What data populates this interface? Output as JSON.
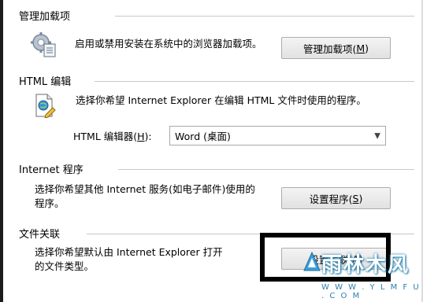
{
  "addons": {
    "title": "管理加载项",
    "description": "启用或禁用安装在系统中的浏览器加载项。",
    "button_text": "管理加载项(",
    "button_key": "M",
    "button_close": ")"
  },
  "html_editor": {
    "title": "HTML 编辑",
    "description": "选择你希望 Internet Explorer 在编辑 HTML 文件时使用的程序。",
    "label_text": "HTML 编辑器(",
    "label_key": "H",
    "label_close": "):",
    "selected": "Word (桌面)"
  },
  "internet_programs": {
    "title": "Internet 程序",
    "description_line1": "选择你希望其他 Internet 服务(如电子邮件)使用的",
    "description_line2": "程序。",
    "button_text": "设置程序(",
    "button_key": "S",
    "button_close": ")"
  },
  "file_assoc": {
    "title": "文件关联",
    "description_line1": "选择你希望默认由 Internet Explorer 打开",
    "description_line2": "的文件类型。",
    "button_text": "设置关联(",
    "button_key": "A",
    "button_close": ")"
  },
  "watermark": {
    "text": "雨林木风",
    "url": "W W W . Y L M F U . C O M"
  }
}
